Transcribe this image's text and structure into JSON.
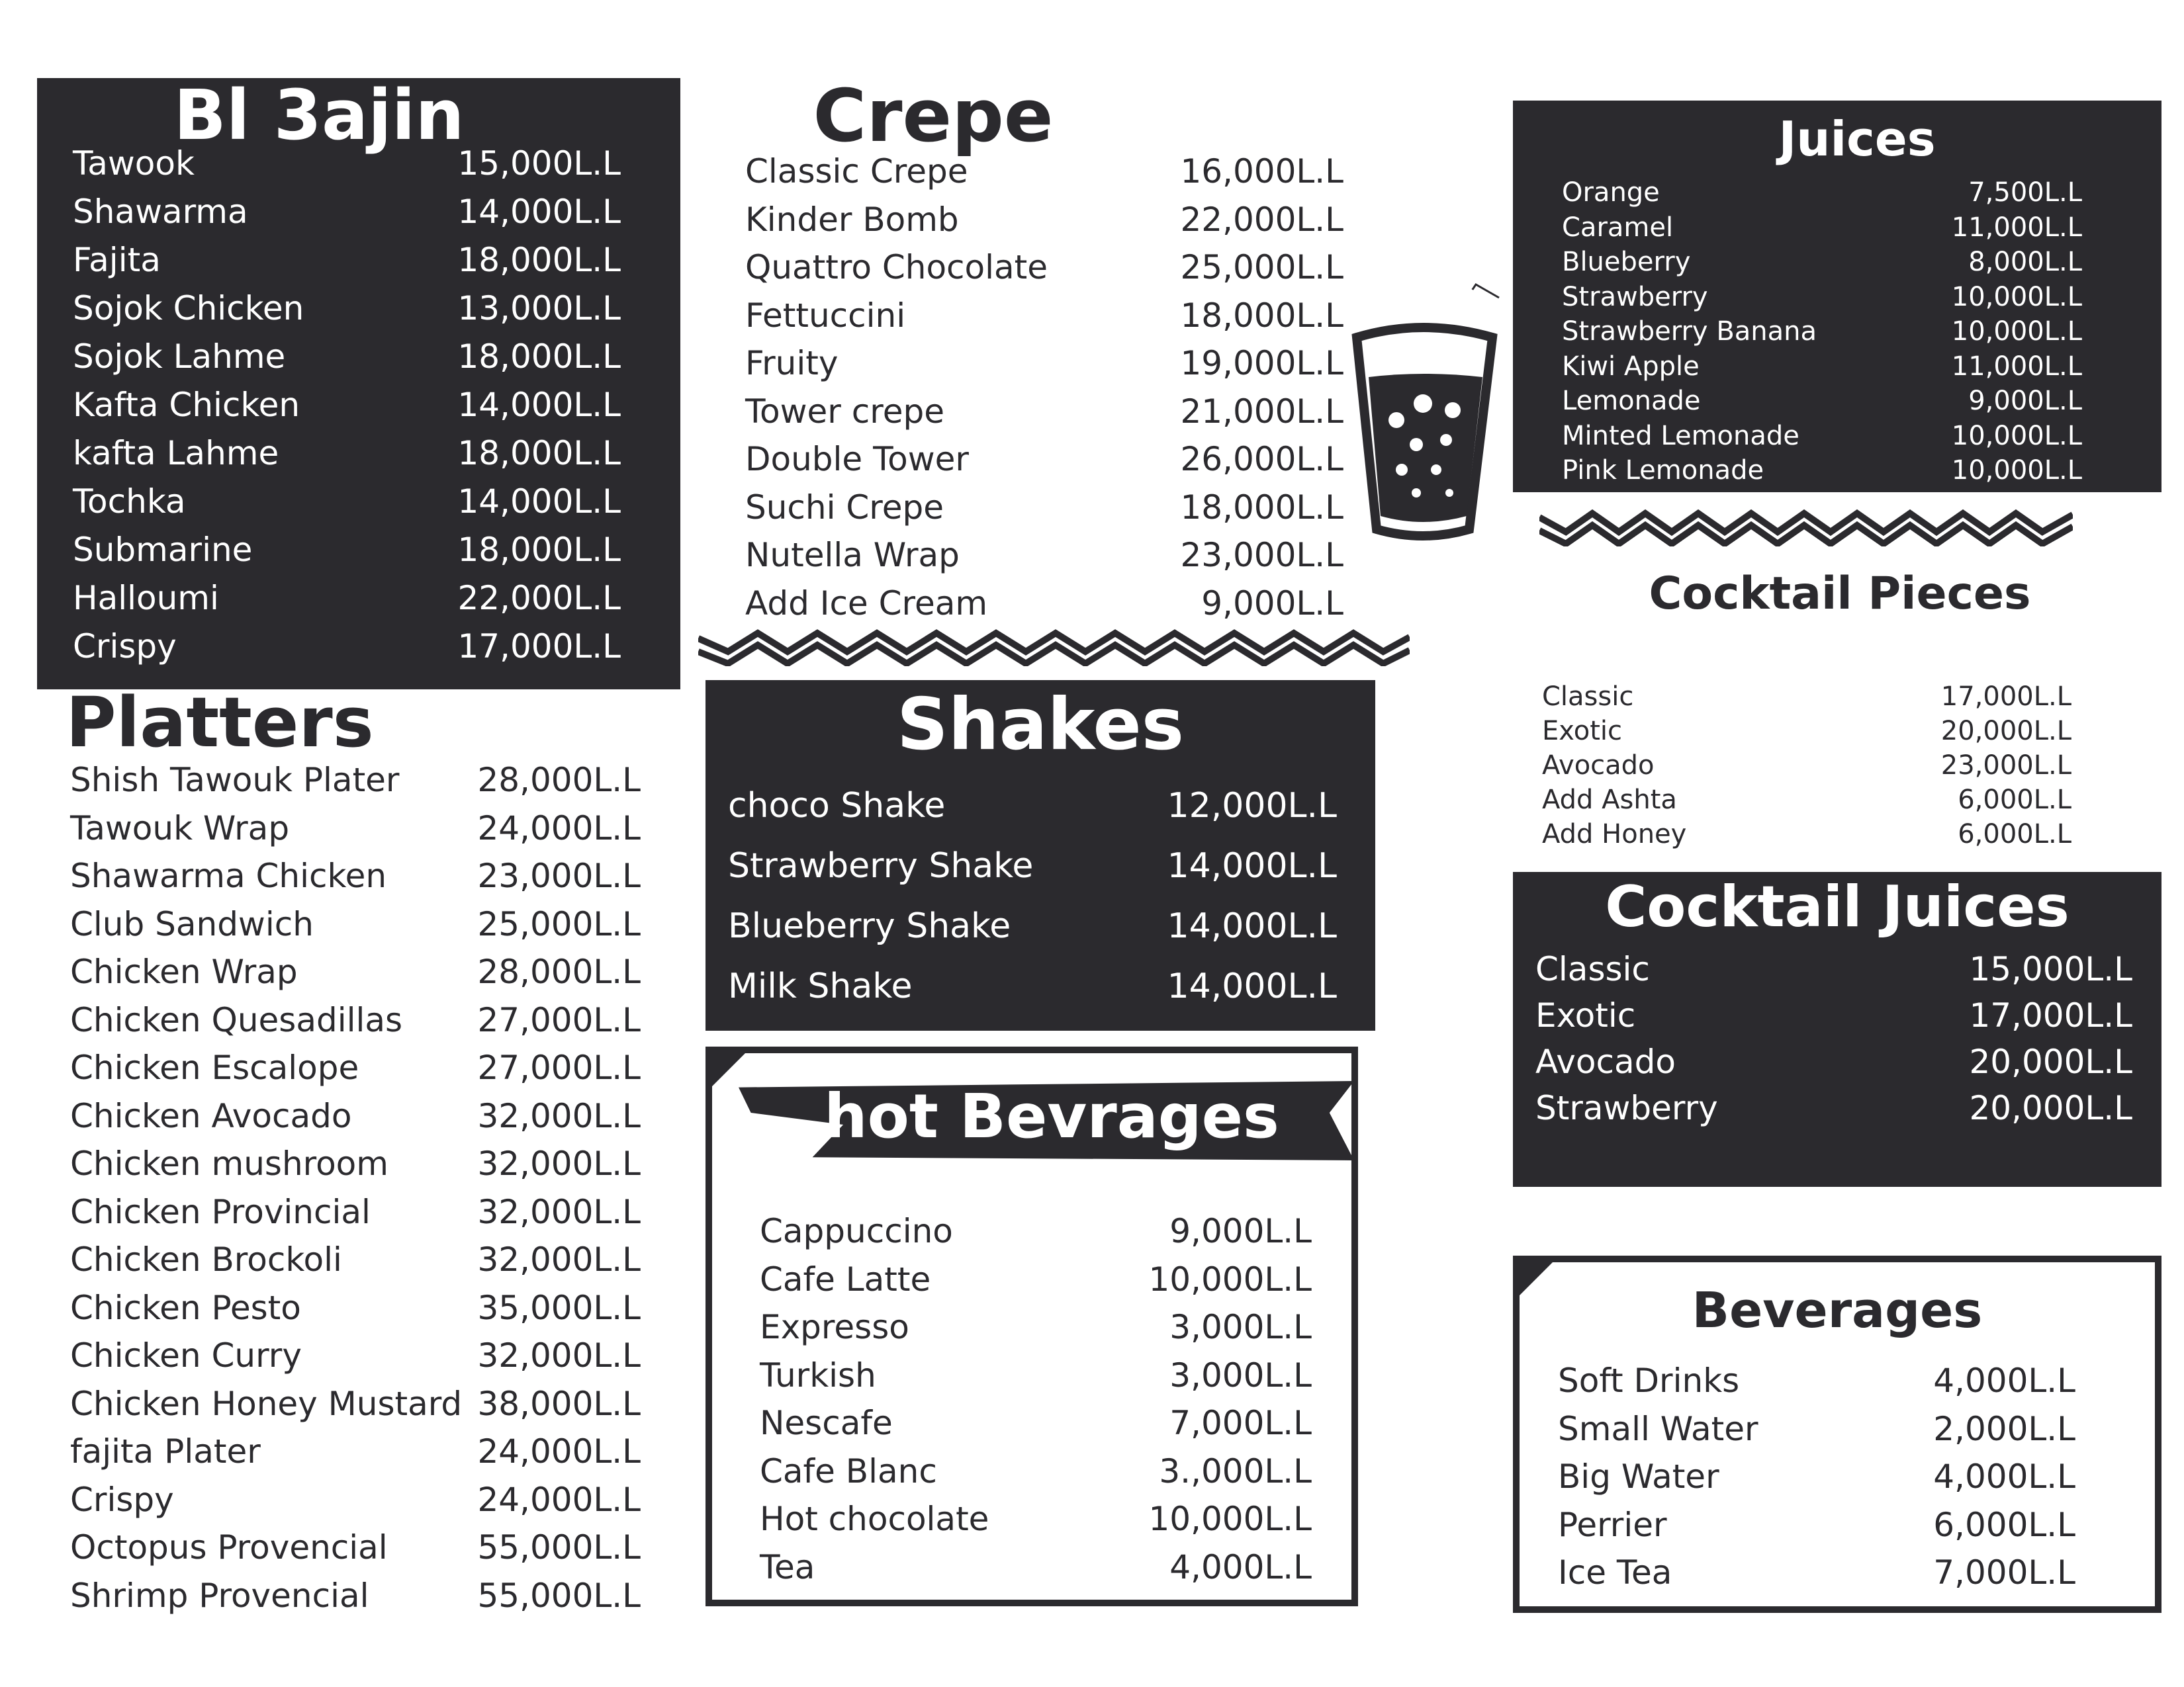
{
  "bl3ajin": {
    "title": "Bl 3ajin",
    "items": [
      {
        "name": "Tawook",
        "price": "15,000L.L"
      },
      {
        "name": "Shawarma",
        "price": "14,000L.L"
      },
      {
        "name": "Fajita",
        "price": "18,000L.L"
      },
      {
        "name": "Sojok Chicken",
        "price": "13,000L.L"
      },
      {
        "name": "Sojok Lahme",
        "price": "18,000L.L"
      },
      {
        "name": "Kafta Chicken",
        "price": "14,000L.L"
      },
      {
        "name": "kafta Lahme",
        "price": "18,000L.L"
      },
      {
        "name": "Tochka",
        "price": "14,000L.L"
      },
      {
        "name": "Submarine",
        "price": "18,000L.L"
      },
      {
        "name": "Halloumi",
        "price": "22,000L.L"
      },
      {
        "name": "Crispy",
        "price": "17,000L.L"
      }
    ]
  },
  "platters": {
    "title": "Platters",
    "items": [
      {
        "name": "Shish Tawouk Plater",
        "price": "28,000L.L"
      },
      {
        "name": "Tawouk Wrap",
        "price": "24,000L.L"
      },
      {
        "name": "Shawarma Chicken",
        "price": "23,000L.L"
      },
      {
        "name": "Club Sandwich",
        "price": "25,000L.L"
      },
      {
        "name": "Chicken Wrap",
        "price": "28,000L.L"
      },
      {
        "name": "Chicken Quesadillas",
        "price": "27,000L.L"
      },
      {
        "name": "Chicken Escalope",
        "price": "27,000L.L"
      },
      {
        "name": "Chicken Avocado",
        "price": "32,000L.L"
      },
      {
        "name": "Chicken mushroom",
        "price": "32,000L.L"
      },
      {
        "name": "Chicken Provincial",
        "price": "32,000L.L"
      },
      {
        "name": "Chicken Brockoli",
        "price": "32,000L.L"
      },
      {
        "name": "Chicken Pesto",
        "price": "35,000L.L"
      },
      {
        "name": "Chicken Curry",
        "price": "32,000L.L"
      },
      {
        "name": "Chicken Honey Mustard",
        "price": "38,000L.L"
      },
      {
        "name": "fajita Plater",
        "price": "24,000L.L"
      },
      {
        "name": "Crispy",
        "price": "24,000L.L"
      },
      {
        "name": "Octopus Provencial",
        "price": "55,000L.L"
      },
      {
        "name": "Shrimp Provencial",
        "price": "55,000L.L"
      }
    ]
  },
  "crepe": {
    "title": "Crepe",
    "items": [
      {
        "name": "Classic Crepe",
        "price": "16,000L.L"
      },
      {
        "name": "Kinder Bomb",
        "price": "22,000L.L"
      },
      {
        "name": "Quattro Chocolate",
        "price": "25,000L.L"
      },
      {
        "name": "Fettuccini",
        "price": "18,000L.L"
      },
      {
        "name": "Fruity",
        "price": "19,000L.L"
      },
      {
        "name": "Tower crepe",
        "price": "21,000L.L"
      },
      {
        "name": "Double Tower",
        "price": "26,000L.L"
      },
      {
        "name": "Suchi Crepe",
        "price": "18,000L.L"
      },
      {
        "name": "Nutella Wrap",
        "price": "23,000L.L"
      },
      {
        "name": "Add Ice Cream",
        "price": "9,000L.L"
      }
    ]
  },
  "shakes": {
    "title": "Shakes",
    "items": [
      {
        "name": "choco Shake",
        "price": "12,000L.L"
      },
      {
        "name": "Strawberry Shake",
        "price": "14,000L.L"
      },
      {
        "name": "Blueberry Shake",
        "price": "14,000L.L"
      },
      {
        "name": "Milk Shake",
        "price": "14,000L.L"
      }
    ]
  },
  "hot_beverages": {
    "title": "hot Bevrages",
    "items": [
      {
        "name": "Cappuccino",
        "price": "9,000L.L"
      },
      {
        "name": "Cafe Latte",
        "price": "10,000L.L"
      },
      {
        "name": "Expresso",
        "price": "3,000L.L"
      },
      {
        "name": "Turkish",
        "price": "3,000L.L"
      },
      {
        "name": "Nescafe",
        "price": "7,000L.L"
      },
      {
        "name": "Cafe Blanc",
        "price": "3.,000L.L"
      },
      {
        "name": "Hot chocolate",
        "price": "10,000L.L"
      },
      {
        "name": "Tea",
        "price": "4,000L.L"
      }
    ]
  },
  "juices": {
    "title": "Juices",
    "items": [
      {
        "name": "Orange",
        "price": "7,500L.L"
      },
      {
        "name": "Caramel",
        "price": "11,000L.L"
      },
      {
        "name": "Blueberry",
        "price": "8,000L.L"
      },
      {
        "name": "Strawberry",
        "price": "10,000L.L"
      },
      {
        "name": "Strawberry Banana",
        "price": "10,000L.L"
      },
      {
        "name": "Kiwi Apple",
        "price": "11,000L.L"
      },
      {
        "name": "Lemonade",
        "price": "9,000L.L"
      },
      {
        "name": "Minted Lemonade",
        "price": "10,000L.L"
      },
      {
        "name": "Pink Lemonade",
        "price": "10,000L.L"
      }
    ]
  },
  "cocktail_pieces": {
    "title": "Cocktail Pieces",
    "items": [
      {
        "name": "Classic",
        "price": "17,000L.L"
      },
      {
        "name": "Exotic",
        "price": "20,000L.L"
      },
      {
        "name": "Avocado",
        "price": "23,000L.L"
      },
      {
        "name": "Add Ashta",
        "price": "6,000L.L"
      },
      {
        "name": "Add Honey",
        "price": "6,000L.L"
      }
    ]
  },
  "cocktail_juices": {
    "title": "Cocktail Juices",
    "items": [
      {
        "name": "Classic",
        "price": "15,000L.L"
      },
      {
        "name": "Exotic",
        "price": "17,000L.L"
      },
      {
        "name": "Avocado",
        "price": "20,000L.L"
      },
      {
        "name": "Strawberry",
        "price": "20,000L.L"
      }
    ]
  },
  "beverages": {
    "title": "Beverages",
    "items": [
      {
        "name": "Soft Drinks",
        "price": "4,000L.L"
      },
      {
        "name": "Small Water",
        "price": "2,000L.L"
      },
      {
        "name": "Big Water",
        "price": "4,000L.L"
      },
      {
        "name": "Perrier",
        "price": "6,000L.L"
      },
      {
        "name": "Ice Tea",
        "price": "7,000L.L"
      }
    ]
  },
  "colors": {
    "ink": "#2b2a2e",
    "paper": "#ffffff"
  },
  "icons": [
    "drink-cup-icon",
    "zigzag-divider"
  ]
}
